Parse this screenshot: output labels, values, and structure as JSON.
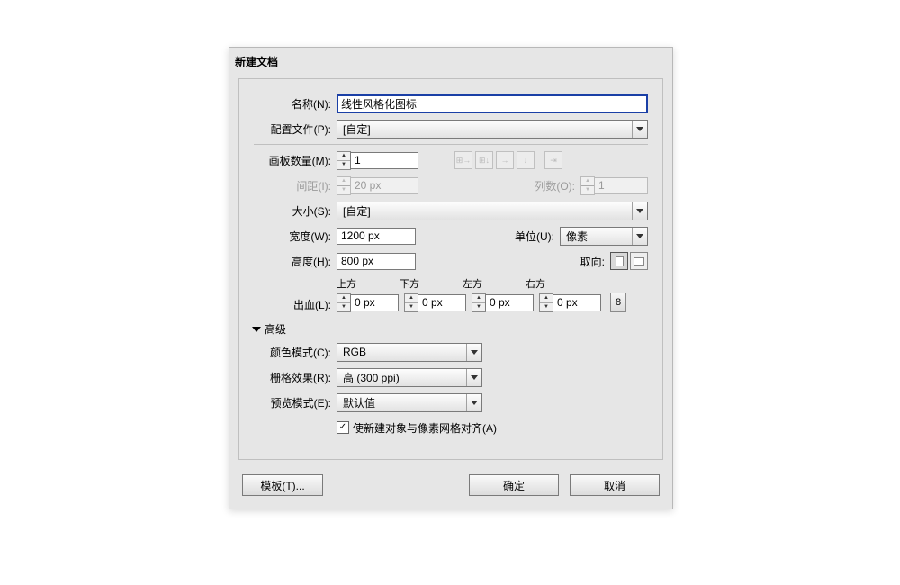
{
  "dialog": {
    "title": "新建文档",
    "name_label": "名称(N):",
    "name_value": "线性风格化图标",
    "profile_label": "配置文件(P):",
    "profile_value": "[自定]",
    "boards_label": "画板数量(M):",
    "boards_value": "1",
    "spacing_label": "间距(I):",
    "spacing_value": "20 px",
    "cols_label": "列数(O):",
    "cols_value": "1",
    "size_label": "大小(S):",
    "size_value": "[自定]",
    "width_label": "宽度(W):",
    "width_value": "1200 px",
    "height_label": "高度(H):",
    "height_value": "800 px",
    "unit_label": "单位(U):",
    "unit_value": "像素",
    "orient_label": "取向:",
    "bleed_label": "出血(L):",
    "bleed_top": "上方",
    "bleed_bottom": "下方",
    "bleed_left": "左方",
    "bleed_right": "右方",
    "bleed_val": "0 px",
    "advanced": "高级",
    "colormode_label": "颜色模式(C):",
    "colormode_value": "RGB",
    "raster_label": "栅格效果(R):",
    "raster_value": "高 (300 ppi)",
    "preview_label": "预览模式(E):",
    "preview_value": "默认值",
    "align_check": "使新建对象与像素网格对齐(A)",
    "link_glyph": "8",
    "template_btn": "模板(T)...",
    "ok_btn": "确定",
    "cancel_btn": "取消"
  }
}
